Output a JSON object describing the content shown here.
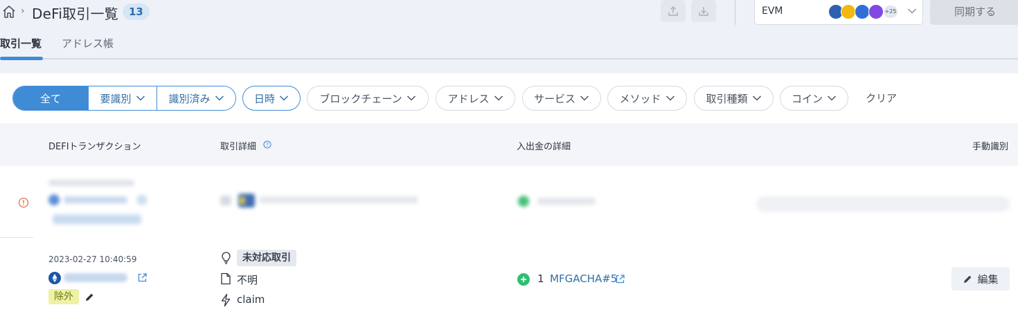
{
  "header": {
    "title": "DeFi取引一覧",
    "count": "13",
    "chain": "EVM",
    "more_chains": "+25",
    "sync_label": "同期する"
  },
  "tabs": [
    {
      "label": "取引一覧"
    },
    {
      "label": "アドレス帳"
    }
  ],
  "filters": {
    "all": "全て",
    "unidentified": "要識別",
    "identified": "識別済み",
    "date": "日時",
    "blockchain": "ブロックチェーン",
    "address": "アドレス",
    "service": "サービス",
    "method": "メソッド",
    "tx_type": "取引種類",
    "coin": "コイン",
    "clear": "クリア"
  },
  "table": {
    "headers": {
      "defi_tx": "DEFIトランザクション",
      "details": "取引詳細",
      "inout": "入出金の詳細",
      "manual": "手動識別"
    },
    "row": {
      "date": "2023-02-27 10:40:59",
      "status_badge": "除外",
      "tx_badge": "未対応取引",
      "type": "不明",
      "method": "claim",
      "qty": "1",
      "asset": "MFGACHA#5",
      "edit_label": "編集"
    }
  },
  "colors": {
    "accent": "#3f8bd6",
    "excluded_bg": "#eef1a6",
    "plus_green": "#2fbf71",
    "warning": "#e8704a"
  }
}
